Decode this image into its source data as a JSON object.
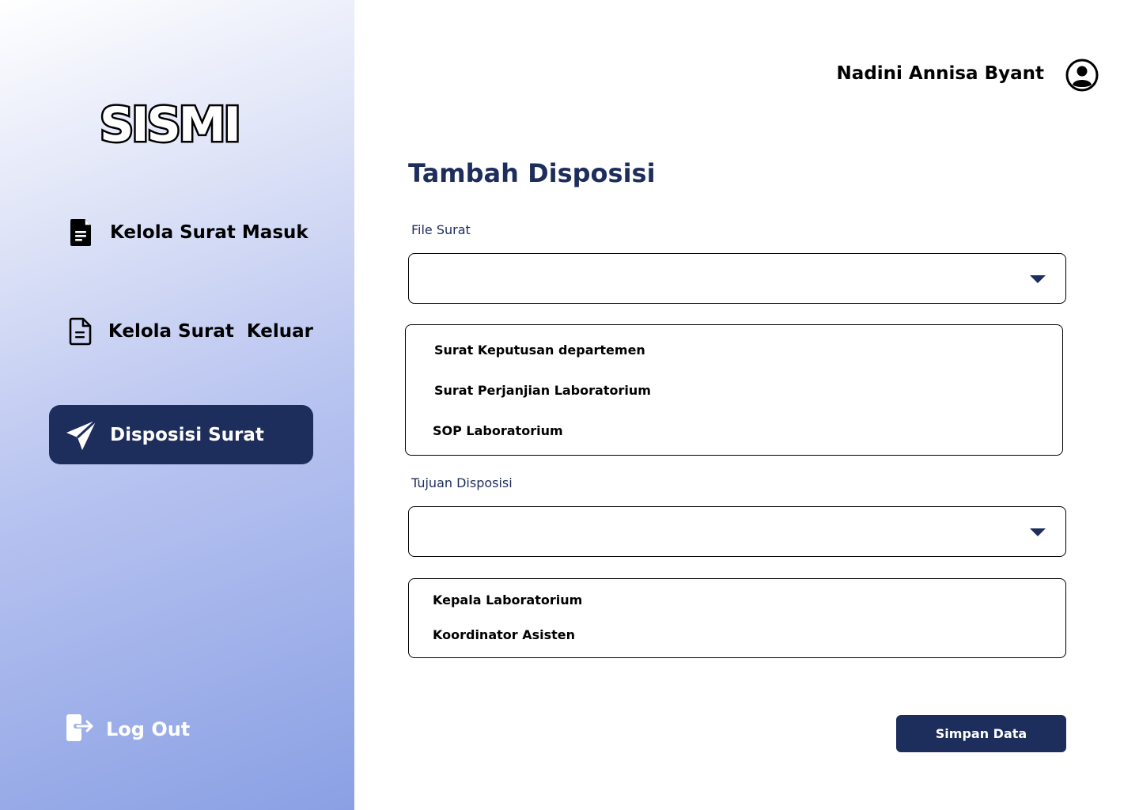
{
  "app": {
    "logo_text": "SISMI"
  },
  "sidebar": {
    "items": [
      {
        "label": "Kelola Surat Masuk",
        "icon": "file-filled-icon"
      },
      {
        "label": "Kelola Surat  Keluar",
        "icon": "file-outline-icon"
      },
      {
        "label": "Disposisi Surat",
        "icon": "paper-plane-icon",
        "active": true
      }
    ],
    "logout_label": "Log Out"
  },
  "header": {
    "user_name": "Nadini Annisa Byant"
  },
  "main": {
    "title": "Tambah Disposisi",
    "file_surat": {
      "label": "File Surat",
      "value": "",
      "options": [
        "Surat Keputusan departemen",
        "Surat Perjanjian Laboratorium",
        "SOP Laboratorium"
      ]
    },
    "tujuan_disposisi": {
      "label": "Tujuan Disposisi",
      "value": "",
      "options": [
        "Kepala Laboratorium",
        "Koordinator Asisten"
      ]
    },
    "save_label": "Simpan Data"
  },
  "colors": {
    "primary": "#1d2d5c",
    "sidebar_gradient_end": "#8aa0e4"
  }
}
